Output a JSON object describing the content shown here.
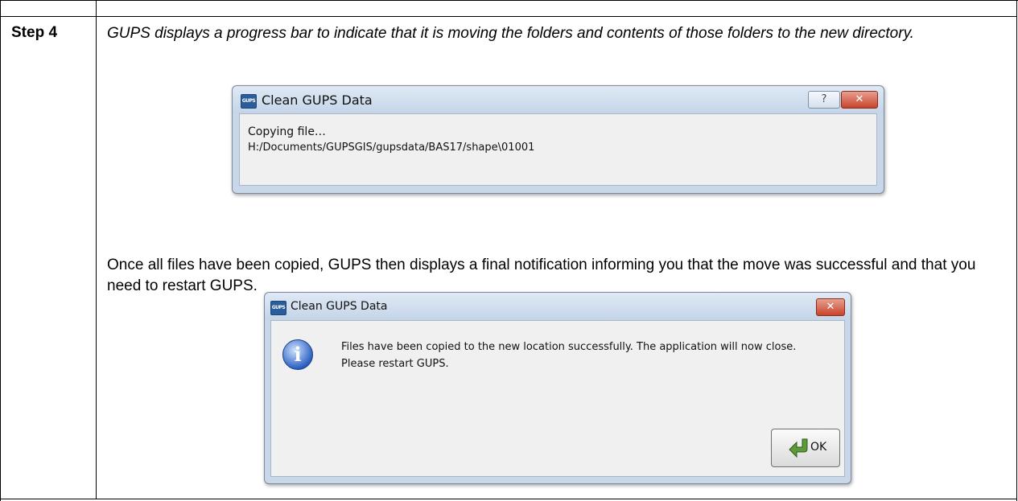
{
  "step": {
    "label": "Step 4"
  },
  "intro": {
    "text": "GUPS displays a progress bar to indicate that it is moving the folders and contents of those folders to the new directory."
  },
  "progress_dialog": {
    "app_icon_text": "GUPS",
    "title": "Clean GUPS Data",
    "help_glyph": "?",
    "close_glyph": "✕",
    "status": "Copying file…",
    "path": "H:/Documents/GUPSGIS/gupsdata/BAS17/shape\\01001"
  },
  "followup": {
    "text": "Once all files have been copied, GUPS then displays a final notification informing you that the move was successful and that you need to restart GUPS."
  },
  "notify_dialog": {
    "app_icon_text": "GUPS",
    "title": "Clean GUPS Data",
    "close_glyph": "✕",
    "info_glyph": "i",
    "message": "Files have been copied to the new location successfully. The application will now close. Please restart GUPS.",
    "ok_label": "OK"
  }
}
